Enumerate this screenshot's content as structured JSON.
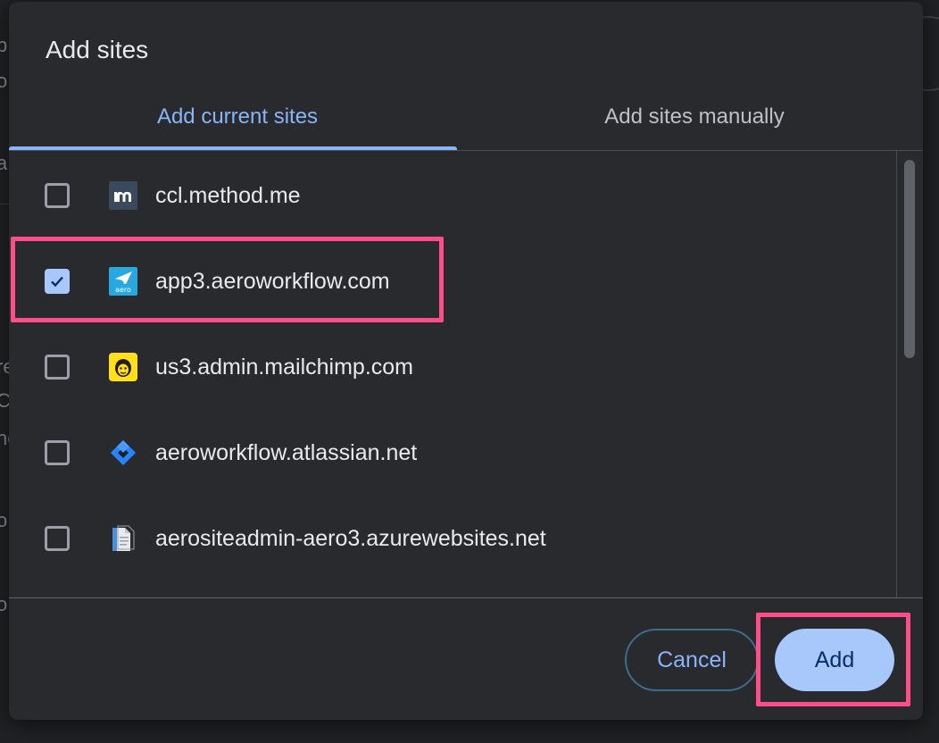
{
  "dialog": {
    "title": "Add sites"
  },
  "tabs": [
    {
      "label": "Add current sites",
      "active": true
    },
    {
      "label": "Add sites manually",
      "active": false
    }
  ],
  "sites": [
    {
      "label": "ccl.method.me",
      "checked": false,
      "icon": "method-icon"
    },
    {
      "label": "app3.aeroworkflow.com",
      "checked": true,
      "icon": "aero-icon"
    },
    {
      "label": "us3.admin.mailchimp.com",
      "checked": false,
      "icon": "mailchimp-icon"
    },
    {
      "label": "aeroworkflow.atlassian.net",
      "checked": false,
      "icon": "jira-icon"
    },
    {
      "label": "aerositeadmin-aero3.azurewebsites.net",
      "checked": false,
      "icon": "document-icon"
    }
  ],
  "buttons": {
    "cancel": "Cancel",
    "add": "Add"
  },
  "background_fragments": [
    "p",
    "o",
    "a",
    "re",
    "Cl",
    "nc",
    "o",
    "o"
  ],
  "colors": {
    "accent": "#8ab4f8",
    "button_fill": "#a8c7fa",
    "highlight": "#ff4d88",
    "dialog_bg": "#292a2d"
  }
}
